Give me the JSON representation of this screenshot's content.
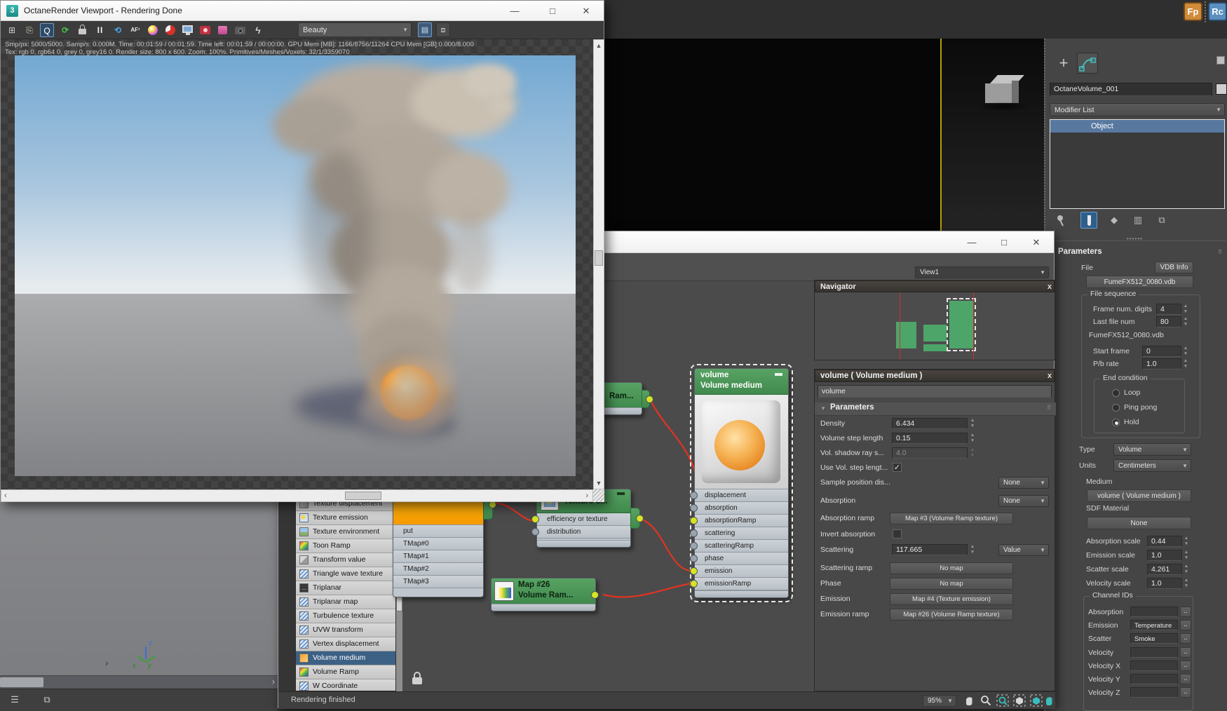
{
  "accent_colors": {
    "node_green": "#4f9d5d",
    "wire_red": "#e23322",
    "pin_yellow": "#d7e421",
    "selection_blue": "#3d6185",
    "viewport_yellow": "#b8a000"
  },
  "desktop_icons": [
    {
      "label": "Fp",
      "color": "#d08a38"
    },
    {
      "label": "Rc",
      "color": "#5a8fc0"
    }
  ],
  "octane_window": {
    "icon_label": "3",
    "title": "OctaneRender Viewport - Rendering Done",
    "toolbar": {
      "render_mode": "Beauty",
      "icons": [
        {
          "name": "layout-icon",
          "glyph": "⊞"
        },
        {
          "name": "clipboard-icon",
          "glyph": "⎘"
        },
        {
          "name": "focus-pick-icon",
          "glyph": "Q"
        },
        {
          "name": "restart-render-icon",
          "glyph": "⟳"
        },
        {
          "name": "lock-icon",
          "glyph": ""
        },
        {
          "name": "pause-icon",
          "glyph": "II"
        },
        {
          "name": "refresh-icon",
          "glyph": "⟲"
        },
        {
          "name": "autofocus-icon",
          "glyph": "AF¹"
        },
        {
          "name": "material-ball-icon",
          "glyph": ""
        },
        {
          "name": "render-pie-icon",
          "glyph": ""
        },
        {
          "name": "display-icon",
          "glyph": ""
        },
        {
          "name": "render-camera-icon",
          "glyph": ""
        },
        {
          "name": "film-box-icon",
          "glyph": ""
        },
        {
          "name": "camera-icon",
          "glyph": ""
        },
        {
          "name": "kernel-bolt-icon",
          "glyph": "ϟ"
        }
      ]
    },
    "status_line1": "Smp/px: 5000/5000.   Samp/s: 0.000M.   Time: 00:01:59 / 00:01:59.   Time left: 00:01:59 / 00:00:00.   GPU Mem [MB]: 1166/8756/11264   CPU Mem [GB]:0.000/8.000",
    "status_line2": "Tex: rgb 0, rgb64 0, grey 0, grey16 0.   Render size: 800 x 600.   Zoom: 100%.   Primitives/Meshes/Voxels: 32/1/3359070"
  },
  "node_editor": {
    "view_selector": "View1",
    "navigator": {
      "title": "Navigator",
      "close_label": "x"
    },
    "texture_list": [
      {
        "label": "Texture displacement"
      },
      {
        "label": "Texture emission"
      },
      {
        "label": "Texture environment"
      },
      {
        "label": "Toon Ramp"
      },
      {
        "label": "Transform value"
      },
      {
        "label": "Triangle wave texture"
      },
      {
        "label": "Triplanar"
      },
      {
        "label": "Triplanar map"
      },
      {
        "label": "Turbulence texture"
      },
      {
        "label": "UVW transform"
      },
      {
        "label": "Vertex displacement"
      },
      {
        "label": "Volume medium"
      },
      {
        "label": "Volume Ramp"
      },
      {
        "label": "W Coordinate"
      }
    ],
    "nodes": {
      "tmap": {
        "rows": [
          "put",
          "TMap#0",
          "TMap#1",
          "TMap#2",
          "TMap#3"
        ]
      },
      "texture_emission": {
        "title": "Texture e...",
        "inputs": [
          "efficiency or texture",
          "distribution"
        ]
      },
      "map3": {
        "title": "Ram..."
      },
      "map26": {
        "title": "Map #26",
        "subtitle": "Volume Ram..."
      },
      "volume": {
        "title": "volume",
        "subtitle": "Volume medium",
        "pins": [
          "displacement",
          "absorption",
          "absorptionRamp",
          "scattering",
          "scatteringRamp",
          "phase",
          "emission",
          "emissionRamp"
        ]
      }
    },
    "properties": {
      "title": "volume ( Volume medium )",
      "close_label": "x",
      "name_value": "volume",
      "rollout": "Parameters",
      "density": {
        "label": "Density",
        "value": "6.434"
      },
      "vstep": {
        "label": "Volume step length",
        "value": "0.15"
      },
      "vshadow": {
        "label": "Vol. shadow ray s...",
        "value": "4.0"
      },
      "usevol": {
        "label": "Use Vol. step lengt..."
      },
      "samplepos": {
        "label": "Sample position dis...",
        "value": "None"
      },
      "absorption": {
        "label": "Absorption",
        "value": "None"
      },
      "absramp": {
        "label": "Absorption ramp",
        "value": "Map #3 (Volume Ramp texture)"
      },
      "invabs": {
        "label": "Invert absorption"
      },
      "scattering": {
        "label": "Scattering",
        "value": "117.665",
        "mode": "Value"
      },
      "scatramp": {
        "label": "Scattering ramp",
        "value": "No map"
      },
      "phase": {
        "label": "Phase",
        "value": "No map"
      },
      "emission": {
        "label": "Emission",
        "value": "Map #4 (Texture emission)"
      },
      "emisramp": {
        "label": "Emission ramp",
        "value": "Map #26 (Volume Ramp texture)"
      }
    },
    "status_bar": {
      "text": "Rendering finished",
      "zoom": "95%"
    }
  },
  "command_panel": {
    "object_name": "OctaneVolume_001",
    "modifier_list_label": "Modifier List",
    "stack": [
      "Object"
    ],
    "parameters": {
      "rollout": "Parameters",
      "file_label": "File",
      "vdb_info_label": "VDB Info",
      "file_button": "FumeFX512_0080.vdb",
      "file_sequence_group": "File sequence",
      "frame_digits": {
        "label": "Frame num. digits",
        "value": "4"
      },
      "last_file": {
        "label": "Last file num",
        "value": "80"
      },
      "sequence_name": "FumeFX512_0080.vdb",
      "start_frame": {
        "label": "Start frame",
        "value": "0"
      },
      "pb_rate": {
        "label": "P/b rate",
        "value": "1.0"
      },
      "end_condition": {
        "group": "End condition",
        "options": [
          "Loop",
          "Ping pong",
          "Hold"
        ],
        "selected": "Hold"
      },
      "type": {
        "label": "Type",
        "value": "Volume"
      },
      "units": {
        "label": "Units",
        "value": "Centimeters"
      },
      "medium_label": "Medium",
      "medium_button": "volume ( Volume medium )",
      "sdf_label": "SDF Material",
      "sdf_button": "None",
      "scales": [
        {
          "label": "Absorption scale",
          "value": "0.44"
        },
        {
          "label": "Emission scale",
          "value": "1.0"
        },
        {
          "label": "Scatter scale",
          "value": "4.261"
        },
        {
          "label": "Velocity scale",
          "value": "1.0"
        }
      ],
      "channel_group": "Channel IDs",
      "channels": [
        {
          "label": "Absorption",
          "value": ""
        },
        {
          "label": "Emission",
          "value": "Temperature"
        },
        {
          "label": "Scatter",
          "value": "Smoke"
        },
        {
          "label": "Velocity",
          "value": ""
        },
        {
          "label": "Velocity X",
          "value": ""
        },
        {
          "label": "Velocity Y",
          "value": ""
        },
        {
          "label": "Velocity Z",
          "value": ""
        }
      ],
      "channel_browse_label": ".."
    }
  },
  "viewport_axis": {
    "x": "x",
    "y": "y",
    "z": "z"
  }
}
